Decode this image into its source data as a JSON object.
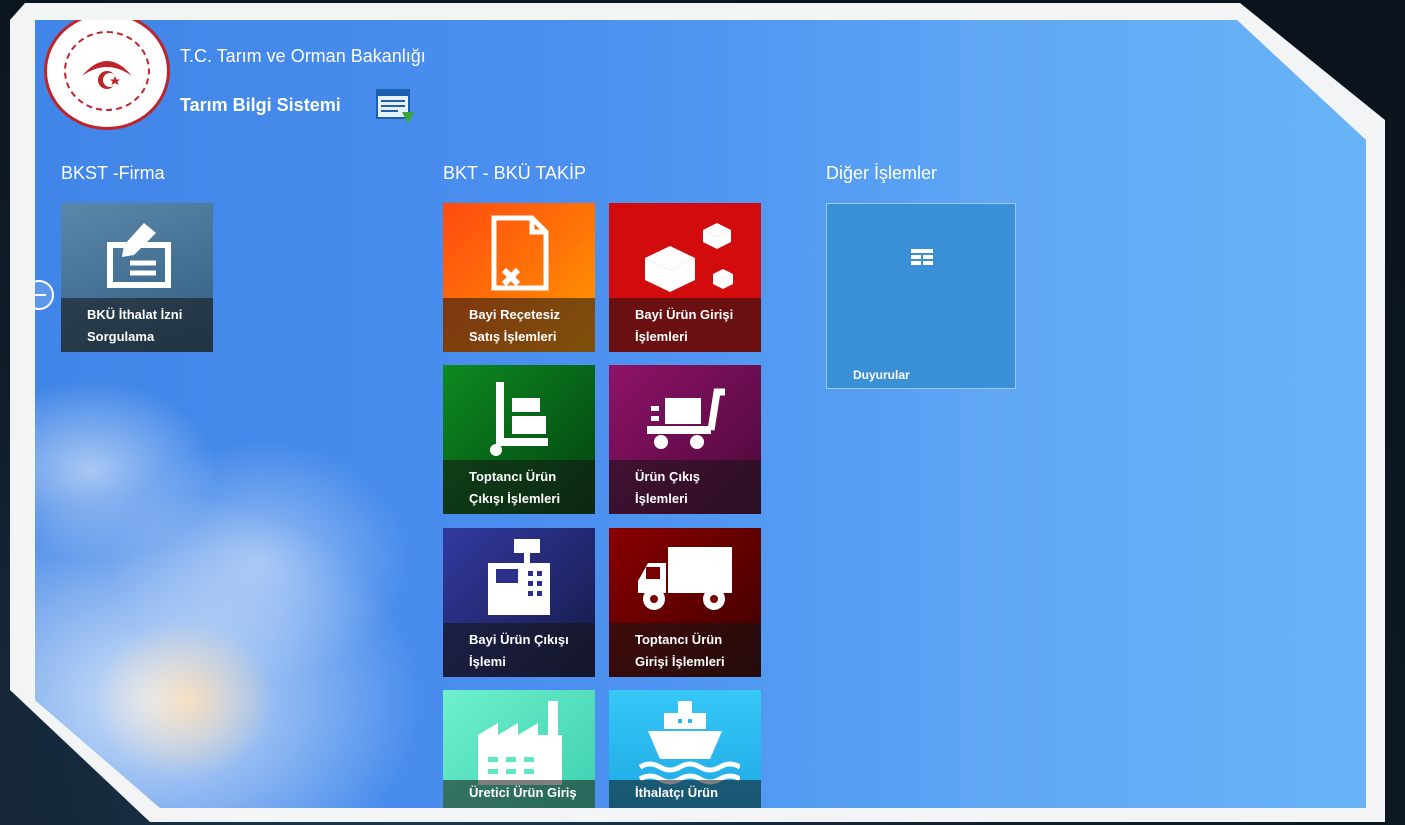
{
  "header": {
    "ministry": "T.C. Tarım ve Orman Bakanlığı",
    "system_title": "Tarım Bilgi Sistemi"
  },
  "sections": [
    {
      "title": "BKST -Firma"
    },
    {
      "title": "BKT - BKÜ TAKİP"
    },
    {
      "title": "Diğer İşlemler"
    }
  ],
  "tiles": {
    "bku_ithalat": {
      "label": "BKÜ İthalat İzni\nSorgulama",
      "color": "#3c6a8d"
    },
    "bayi_recetesiz": {
      "label": "Bayi Reçetesiz\nSatış İşlemleri",
      "color": "#ff6a00"
    },
    "bayi_urun_girisi": {
      "label": "Bayi Ürün Girişi\nİşlemleri",
      "color": "#d31010"
    },
    "toptanci_urun_cikisi": {
      "label": "Toptancı Ürün\nÇıkışı İşlemleri",
      "color": "#0a7a1a"
    },
    "urun_cikis": {
      "label": "Ürün Çıkış\nİşlemleri",
      "color": "#8a1264"
    },
    "bayi_urun_cikisi": {
      "label": "Bayi Ürün Çıkışı\nİşlemi",
      "color": "#2b2f8a"
    },
    "toptanci_urun_girisi": {
      "label": "Toptancı Ürün\nGirişi İşlemleri",
      "color": "#7a0000"
    },
    "uretici_urun_giris": {
      "label": "Üretici Ürün Giriş",
      "color": "#5fe6c2"
    },
    "ithalatci_urun": {
      "label": "İthalatçı Ürün",
      "color": "#29b9f0"
    },
    "duyurular": {
      "label": "Duyurular",
      "color": "#3a90d6"
    }
  }
}
